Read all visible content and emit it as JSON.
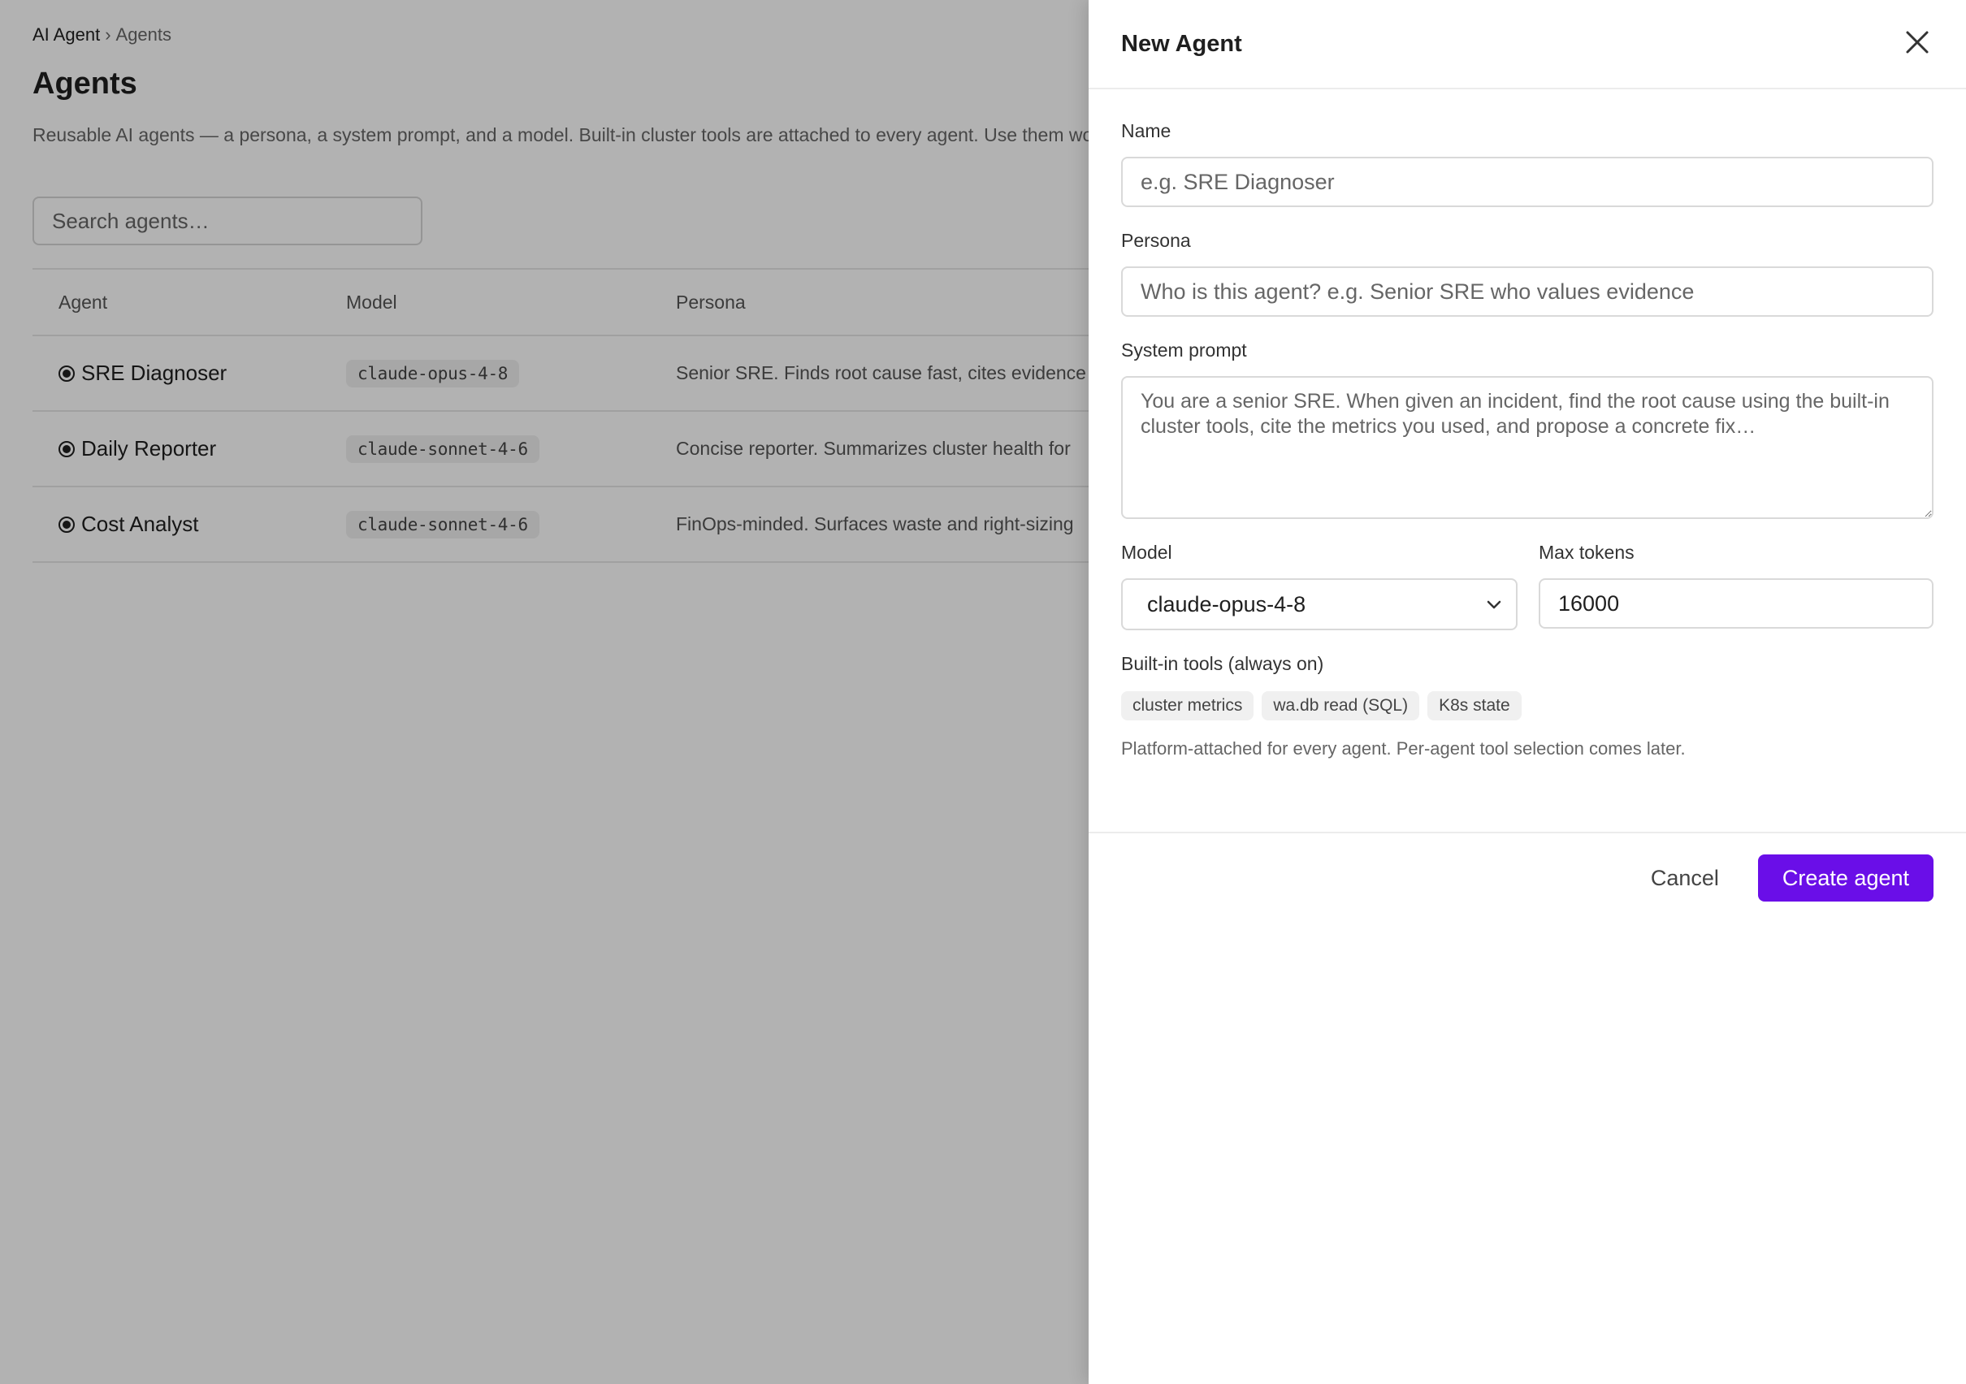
{
  "breadcrumb": {
    "root": "AI Agent",
    "separator": "›",
    "current": "Agents"
  },
  "page": {
    "title": "Agents",
    "description": "Reusable AI agents — a persona, a system prompt, and a model. Built-in cluster tools are attached to every agent. Use them workflows."
  },
  "search": {
    "placeholder": "Search agents…"
  },
  "table": {
    "headers": {
      "agent": "Agent",
      "model": "Model",
      "persona": "Persona"
    },
    "rows": [
      {
        "name": "SRE Diagnoser",
        "model": "claude-opus-4-8",
        "persona": "Senior SRE. Finds root cause fast, cites evidence"
      },
      {
        "name": "Daily Reporter",
        "model": "claude-sonnet-4-6",
        "persona": "Concise reporter. Summarizes cluster health for"
      },
      {
        "name": "Cost Analyst",
        "model": "claude-sonnet-4-6",
        "persona": "FinOps-minded. Surfaces waste and right-sizing"
      }
    ]
  },
  "drawer": {
    "title": "New Agent",
    "name": {
      "label": "Name",
      "placeholder": "e.g. SRE Diagnoser"
    },
    "persona": {
      "label": "Persona",
      "placeholder": "Who is this agent? e.g. Senior SRE who values evidence"
    },
    "system_prompt": {
      "label": "System prompt",
      "placeholder": "You are a senior SRE. When given an incident, find the root cause using the built-in cluster tools, cite the metrics you used, and propose a concrete fix…"
    },
    "model": {
      "label": "Model",
      "value": "claude-opus-4-8"
    },
    "max_tokens": {
      "label": "Max tokens",
      "value": "16000"
    },
    "tools": {
      "label": "Built-in tools (always on)",
      "chips": [
        "cluster metrics",
        "wa.db read (SQL)",
        "K8s state"
      ],
      "note": "Platform-attached for every agent. Per-agent tool selection comes later."
    },
    "cancel_label": "Cancel",
    "create_label": "Create agent"
  },
  "colors": {
    "primary": "#6a0ee8",
    "overlay": "rgba(0,0,0,0.30)"
  }
}
